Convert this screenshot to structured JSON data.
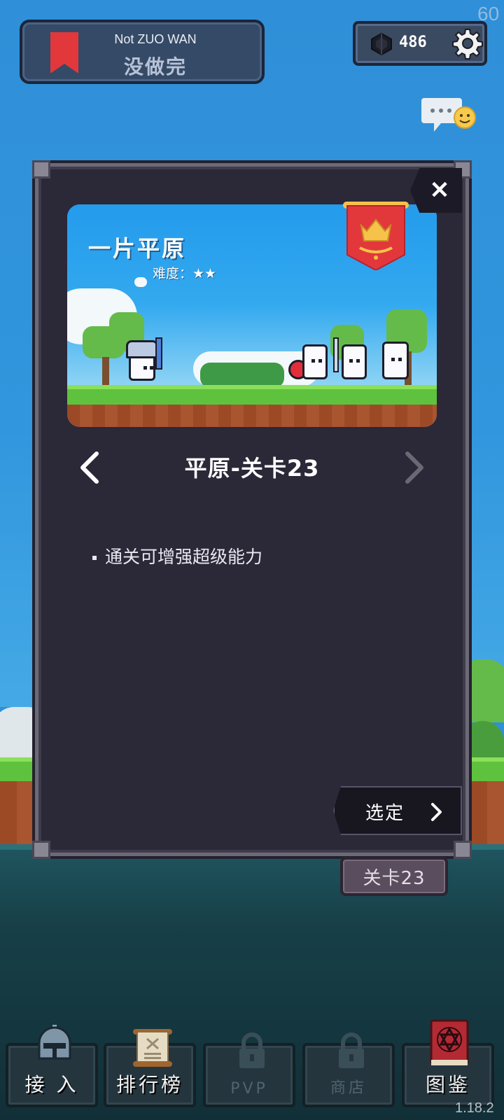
{
  "header": {
    "title_en": "Not ZUO WAN",
    "title_cn": "没做完",
    "currency_value": "486",
    "fps": "60"
  },
  "modal": {
    "card": {
      "title": "一片平原",
      "difficulty": "难度：★★"
    },
    "stage_name": "平原-关卡23",
    "description": "通关可增强超级能力",
    "select_label": "选定"
  },
  "level_tag": "关卡23",
  "tabs": [
    {
      "label": "接 入",
      "icon": "knight-helmet-icon",
      "locked": false
    },
    {
      "label": "排行榜",
      "icon": "scroll-icon",
      "locked": false
    },
    {
      "label": "PVP",
      "icon": "lock-icon",
      "locked": true
    },
    {
      "label": "商店",
      "icon": "lock-icon",
      "locked": true
    },
    {
      "label": "图鉴",
      "icon": "red-book-icon",
      "locked": false
    }
  ],
  "version": "1.18.2",
  "colors": {
    "sky": "#2f8fd8",
    "modal_bg": "#2b2838",
    "banner_red": "#e2383c",
    "crown_gold": "#f7c24a"
  }
}
